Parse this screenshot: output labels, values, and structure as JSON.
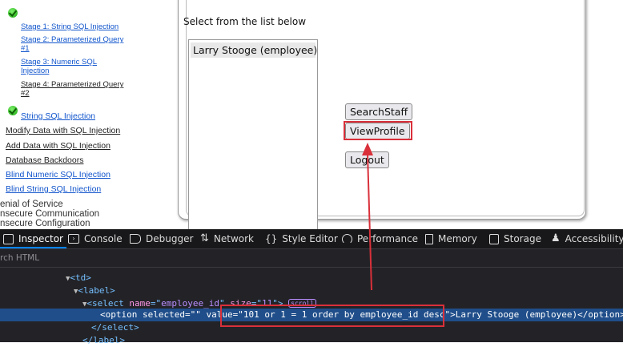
{
  "sidebar": {
    "stages": [
      {
        "label": "Stage 1: String SQL Injection"
      },
      {
        "label": "Stage 2: Parameterized Query #1"
      },
      {
        "label": "Stage 3: Numeric SQL Injection"
      },
      {
        "label": "Stage 4: Parameterized Query #2"
      }
    ],
    "lessons": [
      {
        "label": "String SQL Injection"
      },
      {
        "label": "Modify Data with SQL Injection"
      },
      {
        "label": "Add Data with SQL Injection"
      },
      {
        "label": "Database Backdoors"
      },
      {
        "label": "Blind Numeric SQL Injection"
      },
      {
        "label": "Blind String SQL Injection"
      }
    ],
    "categories": [
      {
        "label": "enial of Service"
      },
      {
        "label": "nsecure Communication"
      },
      {
        "label": "nsecure Configuration"
      }
    ]
  },
  "main": {
    "prompt": "Select from the list below",
    "list_option": "Larry Stooge (employee)",
    "buttons": {
      "search_staff": "SearchStaff",
      "view_profile": "ViewProfile",
      "logout": "Logout"
    }
  },
  "devtools": {
    "tabs": [
      {
        "label": "Inspector",
        "icon": "inspector-icon"
      },
      {
        "label": "Console",
        "icon": "console-icon"
      },
      {
        "label": "Debugger",
        "icon": "debugger-icon"
      },
      {
        "label": "Network",
        "icon": "network-icon"
      },
      {
        "label": "Style Editor",
        "icon": "style-editor-icon"
      },
      {
        "label": "Performance",
        "icon": "performance-icon"
      },
      {
        "label": "Memory",
        "icon": "memory-icon"
      },
      {
        "label": "Storage",
        "icon": "storage-icon"
      },
      {
        "label": "Accessibility",
        "icon": "accessibility-icon"
      }
    ],
    "search_placeholder": "rch HTML",
    "tree": {
      "td_tag": "td",
      "label_tag": "label",
      "select_tag": "select",
      "select_name_attr": "name",
      "select_name_val": "employee_id",
      "select_size_attr": "size",
      "select_size_val": "11",
      "scroll_badge": "scroll",
      "option_tag": "option",
      "option_selected_attr": "selected",
      "option_selected_val": "",
      "option_value_attr": "value",
      "option_value_val": "101 or 1 = 1 order by employee_id desc",
      "option_text": "Larry Stooge (employee)",
      "select_close": "select",
      "label_close": "label"
    }
  },
  "colors": {
    "annotation_red": "#d9303a",
    "link_blue": "#1155cc",
    "devtools_bg": "#232327",
    "selection_blue": "#204e8a"
  }
}
